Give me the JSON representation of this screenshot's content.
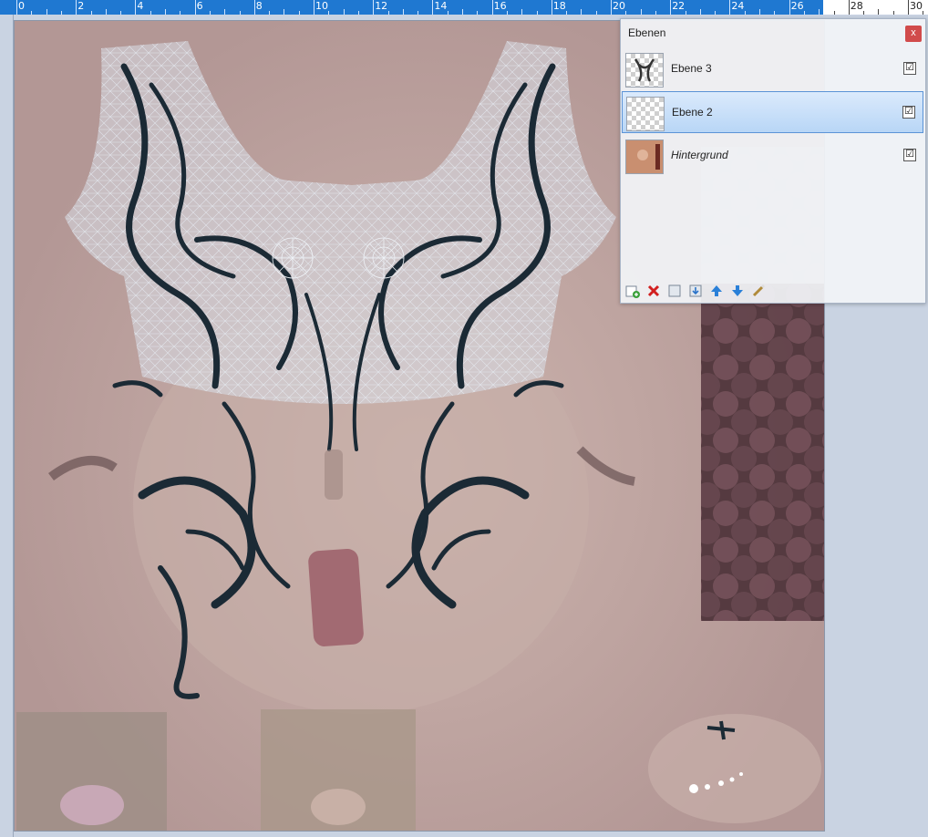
{
  "ruler": {
    "labels": [
      "0",
      "2",
      "4",
      "6",
      "8",
      "10",
      "12",
      "14",
      "16",
      "18",
      "20",
      "22",
      "24",
      "26",
      "28",
      "30"
    ]
  },
  "panel": {
    "title": "Ebenen",
    "close_label": "x",
    "layers": [
      {
        "name": "Ebene 3",
        "checked": "☑",
        "selected": false
      },
      {
        "name": "Ebene 2",
        "checked": "☑",
        "selected": true
      },
      {
        "name": "Hintergrund",
        "checked": "☑",
        "selected": false
      }
    ],
    "toolbar": {
      "add_icon": "add-layer-icon",
      "delete_icon": "delete-layer-icon",
      "duplicate_icon": "duplicate-layer-icon",
      "merge_icon": "merge-down-icon",
      "up_icon": "move-up-icon",
      "down_icon": "move-down-icon",
      "properties_icon": "layer-properties-icon"
    }
  },
  "colors": {
    "ruler_blue": "#1f78d1",
    "tattoo": "#1b2a35",
    "skin": "#b89d9a",
    "close_red": "#d14b4b",
    "selected_border": "#5b93d6"
  }
}
